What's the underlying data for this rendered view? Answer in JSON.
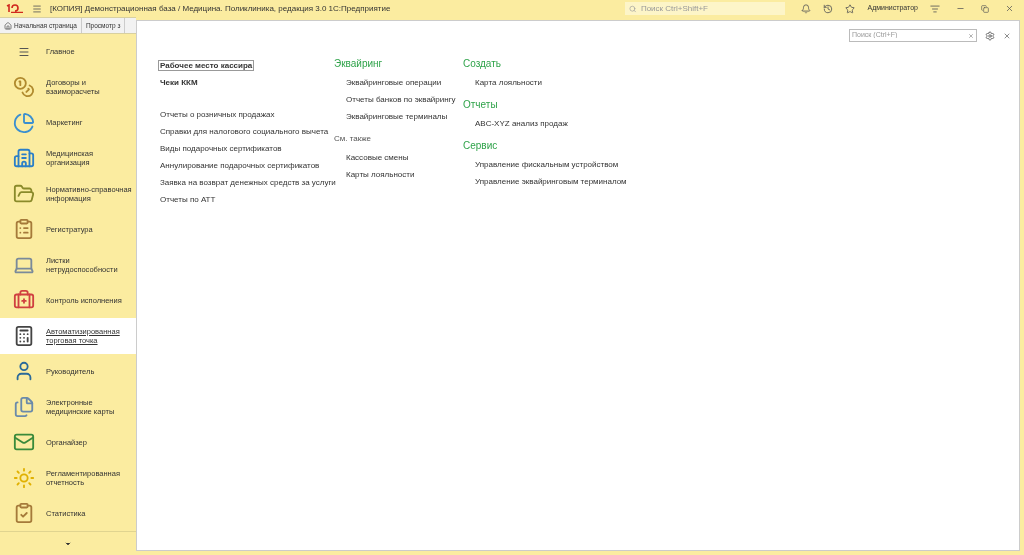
{
  "window": {
    "title": "[КОПИЯ] Демонстрационная база / Медицина. Поликлиника, редакция 3.0 1С:Предприятие",
    "search_placeholder": "Поиск Ctrl+Shift+F",
    "user": "Администратор"
  },
  "tabs": [
    {
      "label": "Начальная страница"
    },
    {
      "label": "Просмотр з"
    }
  ],
  "sidebar": {
    "items": [
      {
        "label": "Главное",
        "selected": false
      },
      {
        "label": "Договоры и взаиморасчеты",
        "selected": false
      },
      {
        "label": "Маркетинг",
        "selected": false
      },
      {
        "label": "Медицинская организация",
        "selected": false
      },
      {
        "label": "Нормативно-справочная информация",
        "selected": false
      },
      {
        "label": "Регистратура",
        "selected": false
      },
      {
        "label": "Листки нетрудоспособности",
        "selected": false
      },
      {
        "label": "Контроль исполнения",
        "selected": false
      },
      {
        "label": "Автоматизированная торговая точка",
        "selected": true
      },
      {
        "label": "Руководитель",
        "selected": false
      },
      {
        "label": "Электронные медицинские карты",
        "selected": false
      },
      {
        "label": "Органайзер",
        "selected": false
      },
      {
        "label": "Регламентированная отчетность",
        "selected": false
      },
      {
        "label": "Статистика",
        "selected": false
      }
    ]
  },
  "content": {
    "search_placeholder": "Поиск (Ctrl+F)",
    "column_1": [
      {
        "label": "Рабочее место кассира",
        "kind": "bold",
        "focused": true
      },
      {
        "label": "Чеки ККМ",
        "kind": "bold",
        "focused": false
      },
      {
        "label": "Отчеты о розничных продажах",
        "kind": "link",
        "focused": false
      },
      {
        "label": "Справки для налогового социального вычета",
        "kind": "link",
        "focused": false
      },
      {
        "label": "Виды подарочных сертификатов",
        "kind": "link",
        "focused": false
      },
      {
        "label": "Аннулирование подарочных сертификатов",
        "kind": "link",
        "focused": false
      },
      {
        "label": "Заявка на возврат денежных средств за услуги",
        "kind": "link",
        "focused": false
      },
      {
        "label": "Отчеты по АТТ",
        "kind": "link",
        "focused": false
      }
    ],
    "column_2": [
      {
        "heading": "Эквайринг",
        "kind": "section",
        "items": [
          "Эквайринговые операции",
          "Отчеты банков по эквайрингу",
          "Эквайринговые терминалы"
        ]
      },
      {
        "heading": "См. также",
        "kind": "see_also",
        "items": [
          "Кассовые смены",
          "Карты лояльности"
        ]
      }
    ],
    "column_3": [
      {
        "heading": "Создать",
        "kind": "section",
        "items": [
          "Карта лояльности"
        ]
      },
      {
        "heading": "Отчеты",
        "kind": "section",
        "items": [
          "ABC-XYZ анализ продаж"
        ]
      },
      {
        "heading": "Сервис",
        "kind": "section",
        "items": [
          "Управление фискальным устройством",
          "Управление эквайринговым терминалом"
        ]
      }
    ]
  }
}
